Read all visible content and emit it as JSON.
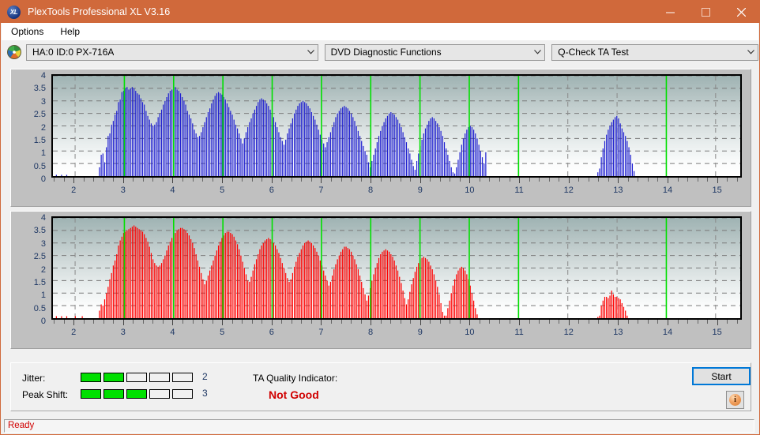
{
  "window": {
    "title": "PlexTools Professional XL V3.16",
    "icon": "plextools-logo-icon",
    "minimize": "–",
    "maximize": "□",
    "close": "✕",
    "titlebar_color": "#d0693b"
  },
  "menu": {
    "items": [
      {
        "label": "Options"
      },
      {
        "label": "Help"
      }
    ]
  },
  "toolbar": {
    "device": {
      "value": "HA:0 ID:0  PX-716A",
      "icon": "disc-drive-icon"
    },
    "function": {
      "value": "DVD Diagnostic Functions"
    },
    "test": {
      "value": "Q-Check TA Test"
    }
  },
  "info": {
    "jitter_label": "Jitter:",
    "jitter_value": "2",
    "jitter_filled": 2,
    "jitter_total": 5,
    "peakshift_label": "Peak Shift:",
    "peakshift_value": "3",
    "peakshift_filled": 3,
    "peakshift_total": 5,
    "tqi_label": "TA Quality Indicator:",
    "tqi_value": "Not Good",
    "tqi_color": "#d00000",
    "start_label": "Start",
    "info_icon": "information-icon",
    "info_glyph": "i"
  },
  "status": {
    "text": "Ready"
  },
  "chart_data": [
    {
      "id": "ta-test-top",
      "type": "bar",
      "title": "",
      "xlabel": "",
      "ylabel": "",
      "series_color": "#1f1fd0",
      "bar_color_light": "#3a3aff",
      "marker_color": "#00e000",
      "grid": true,
      "xlim": [
        1.55,
        15.5
      ],
      "ylim": [
        0,
        4
      ],
      "yticks": [
        0,
        0.5,
        1,
        1.5,
        2,
        2.5,
        3,
        3.5,
        4
      ],
      "ytick_labels": [
        "0",
        "0.5",
        "1",
        "1.5",
        "2",
        "2.5",
        "3",
        "3.5",
        "4"
      ],
      "xticks": [
        2,
        3,
        4,
        5,
        6,
        7,
        8,
        9,
        10,
        11,
        12,
        13,
        14,
        15
      ],
      "xtick_labels": [
        "2",
        "3",
        "4",
        "5",
        "6",
        "7",
        "8",
        "9",
        "10",
        "11",
        "12",
        "13",
        "14",
        "15"
      ],
      "markers": [
        3,
        4,
        5,
        6,
        7,
        8,
        9,
        10,
        11,
        14
      ],
      "bar_step": 0.035,
      "x_start": 1.62,
      "values": [
        0.05,
        0,
        0,
        0.05,
        0,
        0,
        0.05,
        0,
        0,
        0,
        0,
        0,
        0,
        0,
        0,
        0,
        0,
        0,
        0,
        0,
        0,
        0,
        0,
        0,
        0,
        0.35,
        0.85,
        0.9,
        0.55,
        1.15,
        1.6,
        1.7,
        2.05,
        2.2,
        2.45,
        2.6,
        2.95,
        3.05,
        3.35,
        3.4,
        3.5,
        3.55,
        3.45,
        3.5,
        3.55,
        3.5,
        3.4,
        3.3,
        3.25,
        3.1,
        2.95,
        2.85,
        2.6,
        2.4,
        2.25,
        2.1,
        2.0,
        2.05,
        2.15,
        2.35,
        2.5,
        2.65,
        2.85,
        3.0,
        3.15,
        3.3,
        3.4,
        3.45,
        3.5,
        3.55,
        3.45,
        3.4,
        3.3,
        3.15,
        3.0,
        2.85,
        2.6,
        2.45,
        2.3,
        2.1,
        1.85,
        1.7,
        1.55,
        1.6,
        1.75,
        1.95,
        2.15,
        2.35,
        2.55,
        2.7,
        2.9,
        3.05,
        3.2,
        3.3,
        3.35,
        3.3,
        3.25,
        3.15,
        3.05,
        2.9,
        2.75,
        2.6,
        2.45,
        2.25,
        2.05,
        1.9,
        1.7,
        1.5,
        1.3,
        1.5,
        1.75,
        1.95,
        2.15,
        2.3,
        2.5,
        2.65,
        2.8,
        2.95,
        3.05,
        3.1,
        3.05,
        3.0,
        2.9,
        2.8,
        2.65,
        2.5,
        2.35,
        2.15,
        1.95,
        1.75,
        1.55,
        1.4,
        1.25,
        1.45,
        1.7,
        1.9,
        2.1,
        2.3,
        2.5,
        2.65,
        2.8,
        2.9,
        2.95,
        3.0,
        2.95,
        2.9,
        2.8,
        2.7,
        2.55,
        2.4,
        2.25,
        2.05,
        1.85,
        1.65,
        1.45,
        1.3,
        1.15,
        1.35,
        1.55,
        1.75,
        1.95,
        2.15,
        2.35,
        2.5,
        2.6,
        2.7,
        2.75,
        2.8,
        2.75,
        2.7,
        2.6,
        2.5,
        2.35,
        2.2,
        2.0,
        1.8,
        1.6,
        1.4,
        1.2,
        1.0,
        0.85,
        0.55,
        0.35,
        0.6,
        0.85,
        1.1,
        1.35,
        1.6,
        1.8,
        2.0,
        2.15,
        2.3,
        2.4,
        2.5,
        2.55,
        2.5,
        2.45,
        2.35,
        2.25,
        2.1,
        1.95,
        1.75,
        1.55,
        1.35,
        1.1,
        0.9,
        0.65,
        0.4,
        0.25,
        0.6,
        0.9,
        1.2,
        1.45,
        1.7,
        1.9,
        2.05,
        2.2,
        2.3,
        2.35,
        2.3,
        2.2,
        2.1,
        1.95,
        1.8,
        1.6,
        1.35,
        1.1,
        0.85,
        0.6,
        0.35,
        0.15,
        0.1,
        0.35,
        0.65,
        0.95,
        1.25,
        1.5,
        1.7,
        1.85,
        1.95,
        2.0,
        1.95,
        1.85,
        1.7,
        1.5,
        1.25,
        1.0,
        0.75,
        0.5,
        0.95,
        0,
        0,
        0,
        0,
        0,
        0,
        0,
        0,
        0,
        0,
        0,
        0,
        0,
        0,
        0,
        0,
        0,
        0,
        0,
        0,
        0,
        0,
        0,
        0,
        0,
        0,
        0,
        0,
        0,
        0,
        0,
        0,
        0,
        0,
        0,
        0,
        0,
        0,
        0,
        0,
        0,
        0,
        0,
        0,
        0,
        0,
        0,
        0,
        0,
        0,
        0,
        0,
        0,
        0,
        0,
        0,
        0,
        0,
        0,
        0,
        0,
        0,
        0,
        0,
        0.15,
        0.3,
        0.75,
        1.1,
        1.4,
        1.65,
        1.85,
        2.0,
        2.15,
        2.25,
        2.35,
        2.4,
        2.3,
        2.1,
        1.9,
        1.75,
        1.6,
        1.4,
        1.15,
        0.85,
        0.5,
        0.2,
        0,
        0,
        0,
        0,
        0,
        0,
        0,
        0,
        0,
        0,
        0,
        0,
        0,
        0,
        0,
        0,
        0,
        0,
        0
      ]
    },
    {
      "id": "ta-test-bottom",
      "type": "bar",
      "title": "",
      "xlabel": "",
      "ylabel": "",
      "series_color": "#ff0000",
      "bar_color_light": "#ff3a3a",
      "marker_color": "#00e000",
      "grid": true,
      "xlim": [
        1.55,
        15.5
      ],
      "ylim": [
        0,
        4
      ],
      "yticks": [
        0,
        0.5,
        1,
        1.5,
        2,
        2.5,
        3,
        3.5,
        4
      ],
      "ytick_labels": [
        "0",
        "0.5",
        "1",
        "1.5",
        "2",
        "2.5",
        "3",
        "3.5",
        "4"
      ],
      "xticks": [
        2,
        3,
        4,
        5,
        6,
        7,
        8,
        9,
        10,
        11,
        12,
        13,
        14,
        15
      ],
      "xtick_labels": [
        "2",
        "3",
        "4",
        "5",
        "6",
        "7",
        "8",
        "9",
        "10",
        "11",
        "12",
        "13",
        "14",
        "15"
      ],
      "markers": [
        3,
        4,
        5,
        6,
        7,
        8,
        9,
        10,
        11,
        14
      ],
      "bar_step": 0.035,
      "x_start": 1.62,
      "values": [
        0.08,
        0,
        0,
        0.08,
        0,
        0,
        0.08,
        0,
        0,
        0,
        0,
        0.08,
        0,
        0,
        0,
        0.08,
        0,
        0,
        0,
        0,
        0,
        0,
        0,
        0,
        0,
        0.3,
        0.55,
        0.5,
        0.75,
        1.0,
        1.25,
        1.55,
        1.8,
        2.1,
        2.3,
        2.55,
        2.9,
        3.1,
        3.25,
        3.4,
        3.45,
        3.5,
        3.55,
        3.6,
        3.65,
        3.7,
        3.65,
        3.6,
        3.55,
        3.5,
        3.45,
        3.35,
        3.2,
        3.05,
        2.85,
        2.6,
        2.35,
        2.2,
        2.1,
        2.05,
        2.1,
        2.2,
        2.35,
        2.5,
        2.7,
        2.9,
        3.05,
        3.2,
        3.3,
        3.4,
        3.5,
        3.55,
        3.6,
        3.6,
        3.55,
        3.5,
        3.4,
        3.3,
        3.15,
        3.0,
        2.8,
        2.55,
        2.3,
        2.05,
        1.8,
        1.55,
        1.35,
        1.5,
        1.7,
        1.9,
        2.1,
        2.3,
        2.5,
        2.7,
        2.9,
        3.05,
        3.2,
        3.3,
        3.4,
        3.45,
        3.45,
        3.4,
        3.35,
        3.25,
        3.1,
        2.95,
        2.75,
        2.5,
        2.25,
        2.0,
        1.75,
        1.5,
        1.45,
        1.65,
        1.9,
        2.15,
        2.35,
        2.55,
        2.75,
        2.9,
        3.0,
        3.1,
        3.15,
        3.2,
        3.15,
        3.1,
        3.0,
        2.9,
        2.75,
        2.6,
        2.4,
        2.2,
        2.0,
        1.8,
        1.6,
        1.45,
        1.55,
        1.8,
        2.05,
        2.25,
        2.45,
        2.6,
        2.75,
        2.9,
        3.0,
        3.05,
        3.1,
        3.05,
        3.0,
        2.9,
        2.8,
        2.65,
        2.5,
        2.3,
        2.1,
        1.9,
        1.7,
        1.5,
        1.3,
        1.45,
        1.7,
        1.95,
        2.15,
        2.35,
        2.5,
        2.65,
        2.75,
        2.85,
        2.85,
        2.8,
        2.75,
        2.65,
        2.5,
        2.35,
        2.15,
        1.95,
        1.7,
        1.45,
        1.2,
        0.95,
        0.7,
        0.9,
        1.2,
        1.5,
        1.75,
        2.0,
        2.2,
        2.4,
        2.55,
        2.65,
        2.7,
        2.75,
        2.7,
        2.65,
        2.55,
        2.45,
        2.3,
        2.1,
        1.9,
        1.65,
        1.4,
        1.1,
        0.8,
        0.55,
        0.75,
        1.05,
        1.35,
        1.6,
        1.85,
        2.05,
        2.2,
        2.35,
        2.4,
        2.45,
        2.4,
        2.35,
        2.25,
        2.1,
        1.95,
        1.75,
        1.5,
        1.25,
        0.95,
        0.6,
        0.25,
        0.1,
        0.1,
        0.4,
        0.7,
        1.0,
        1.3,
        1.55,
        1.75,
        1.9,
        2.0,
        2.05,
        2.0,
        1.9,
        1.75,
        1.55,
        1.3,
        1.0,
        0.7,
        0.4,
        0.15,
        0,
        0,
        0,
        0,
        0,
        0,
        0,
        0,
        0,
        0,
        0,
        0,
        0,
        0,
        0,
        0,
        0,
        0,
        0,
        0,
        0,
        0,
        0,
        0,
        0,
        0,
        0,
        0,
        0,
        0,
        0,
        0,
        0,
        0,
        0,
        0,
        0,
        0,
        0,
        0,
        0,
        0,
        0,
        0,
        0,
        0,
        0,
        0,
        0,
        0,
        0,
        0,
        0,
        0,
        0,
        0,
        0,
        0,
        0,
        0,
        0,
        0,
        0,
        0,
        0,
        0,
        0,
        0,
        0,
        0.05,
        0.1,
        0.5,
        0.7,
        0.85,
        0.85,
        0.8,
        0.9,
        1.1,
        0.95,
        0.85,
        0.85,
        0.8,
        0.75,
        0.6,
        0.45,
        0.3,
        0.1,
        0,
        0,
        0,
        0,
        0,
        0,
        0,
        0,
        0,
        0,
        0,
        0,
        0,
        0,
        0,
        0,
        0,
        0,
        0,
        0,
        0,
        0,
        0,
        0,
        0,
        0
      ]
    }
  ]
}
